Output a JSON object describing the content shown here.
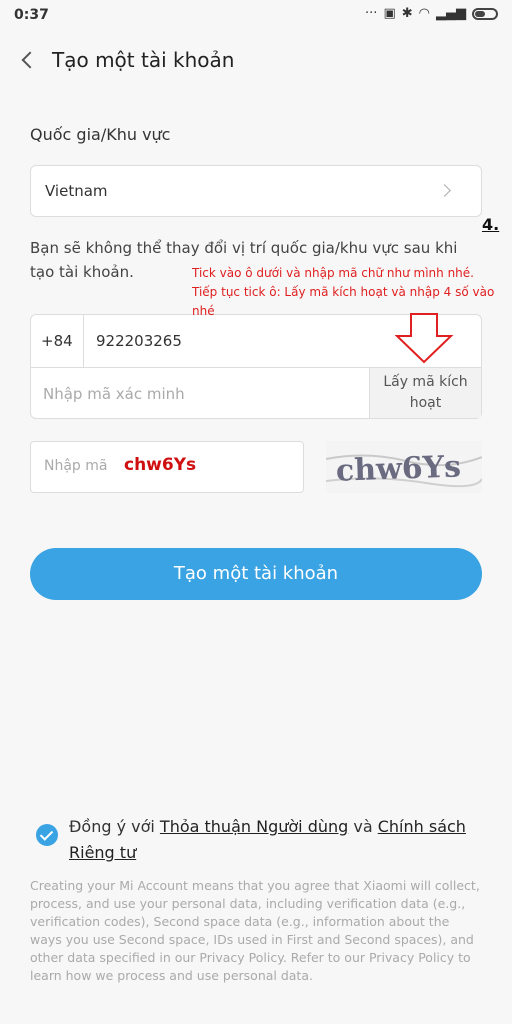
{
  "status_bar": {
    "time": "0:37"
  },
  "header": {
    "title": "Tạo một tài khoản"
  },
  "country": {
    "label": "Quốc gia/Khu vực",
    "value": "Vietnam"
  },
  "annotation": {
    "step": "4.",
    "line1": "Tick vào ô dưới và nhập mã chữ như mình nhé.",
    "line2": "Tiếp tục tick ô: Lấy mã kích hoạt và nhập 4 số vào nhé"
  },
  "info": "Bạn sẽ không thể thay đổi vị trí quốc gia/khu vực sau khi tạo tài khoản.",
  "phone": {
    "country_code": "+84",
    "number": "922203265"
  },
  "verification": {
    "placeholder": "Nhập mã xác minh",
    "get_code_label": "Lấy mã kích hoạt"
  },
  "captcha": {
    "placeholder": "Nhập mã",
    "value": "chw6Ys",
    "image_text": "chw6Ys"
  },
  "create_button": "Tạo một tài khoản",
  "agreement": {
    "prefix": "Đồng ý với ",
    "user_agreement": "Thỏa thuận Người dùng",
    "conj": " và ",
    "privacy_policy": "Chính sách Riêng tư",
    "checked": true
  },
  "legal_text": "Creating your Mi Account means that you agree that Xiaomi will collect, process, and use your personal data, including verification data (e.g., verification codes), Second space data (e.g., information about the ways you use Second space, IDs used in First and Second spaces), and other data specified in our Privacy Policy. Refer to our Privacy Policy to learn how we process and use personal data."
}
